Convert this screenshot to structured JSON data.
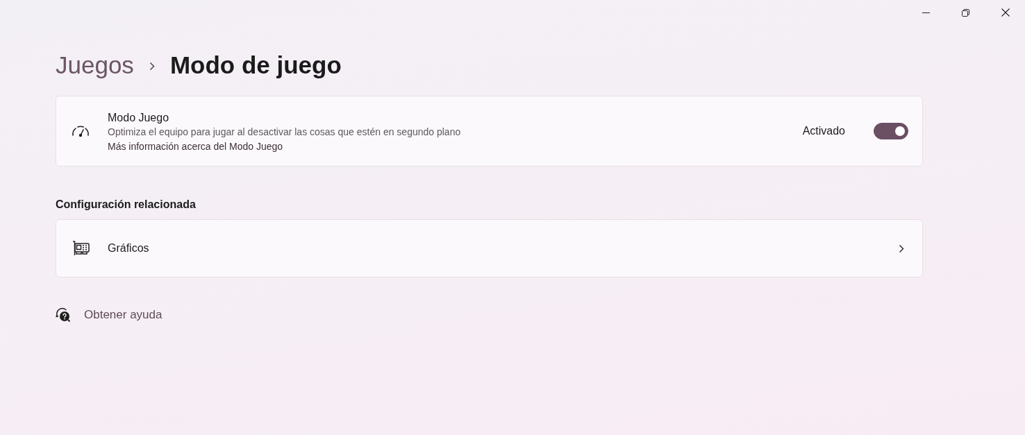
{
  "breadcrumb": [
    {
      "label": "Juegos",
      "current": false
    },
    {
      "label": "Modo de juego",
      "current": true
    }
  ],
  "game_mode": {
    "title": "Modo Juego",
    "description": "Optimiza el equipo para jugar al desactivar las cosas que estén en segundo plano",
    "link": "Más información acerca del Modo Juego",
    "state_label": "Activado",
    "on": true
  },
  "related": {
    "heading": "Configuración relacionada",
    "items": [
      {
        "label": "Gráficos"
      }
    ]
  },
  "help": {
    "label": "Obtener ayuda"
  }
}
